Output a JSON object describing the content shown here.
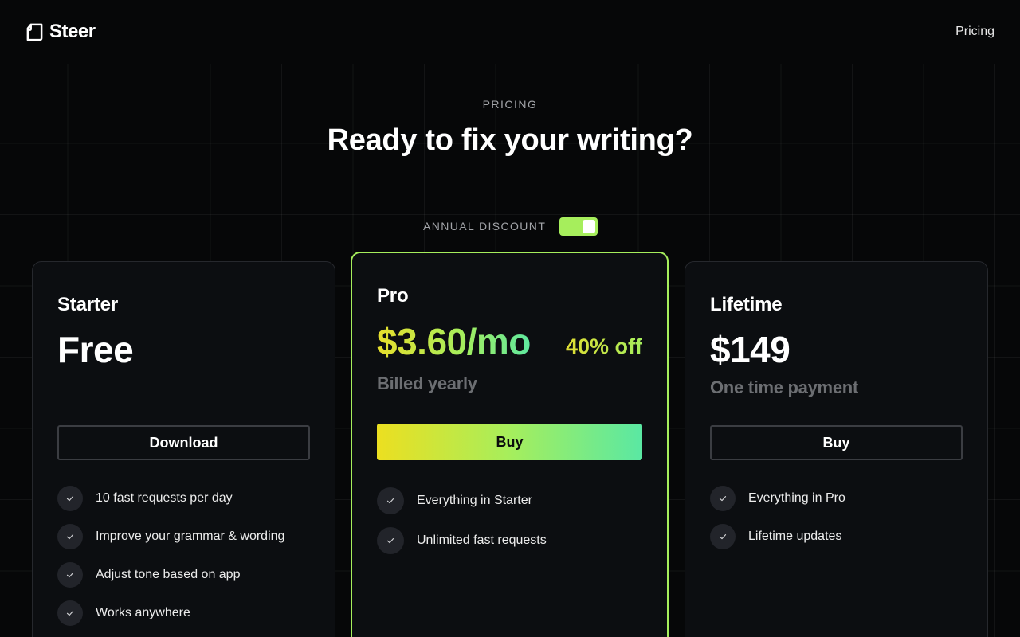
{
  "header": {
    "brand": "Steer",
    "nav": {
      "pricing": "Pricing"
    }
  },
  "hero": {
    "eyebrow": "PRICING",
    "title": "Ready to fix your writing?"
  },
  "toggle": {
    "label": "ANNUAL DISCOUNT",
    "state": "on"
  },
  "plans": {
    "starter": {
      "name": "Starter",
      "price": "Free",
      "button": "Download",
      "features": [
        "10 fast requests per day",
        "Improve your grammar & wording",
        "Adjust tone based on app",
        "Works anywhere"
      ]
    },
    "pro": {
      "name": "Pro",
      "price": "$3.60/mo",
      "discount": "40% off",
      "note": "Billed yearly",
      "button": "Buy",
      "features": [
        "Everything in Starter",
        "Unlimited fast requests"
      ]
    },
    "lifetime": {
      "name": "Lifetime",
      "price": "$149",
      "note": "One time payment",
      "button": "Buy",
      "features": [
        "Everything in Pro",
        "Lifetime updates"
      ]
    }
  },
  "icons": {
    "logo": "steer-logo-icon",
    "check": "check-icon"
  },
  "colors": {
    "background": "#060708",
    "accent": "#a6ee5c",
    "gradient_start": "#ecdf20",
    "gradient_end": "#5ae8a3",
    "card": "#0c0e11",
    "muted": "#6c6e72"
  }
}
